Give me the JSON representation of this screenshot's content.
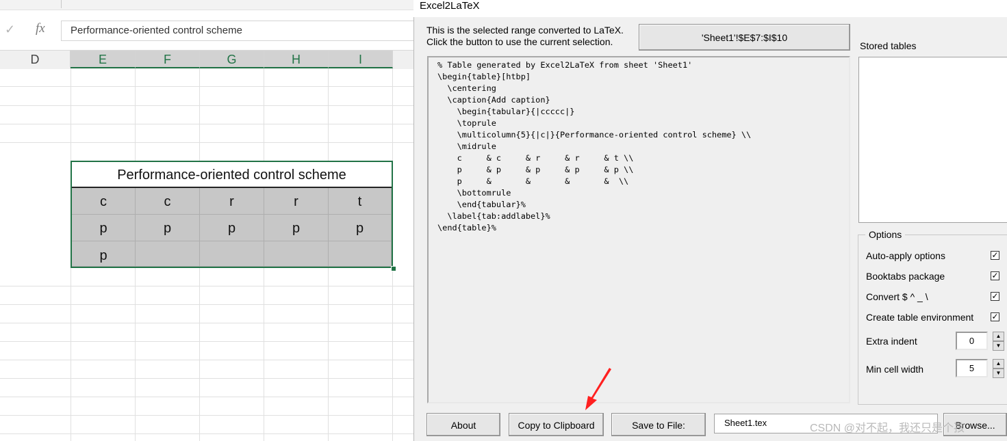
{
  "excel": {
    "formula_bar": {
      "cancel_icon": "check-icon",
      "fx_label": "fx",
      "value": "Performance-oriented control scheme"
    },
    "columns": [
      "D",
      "E",
      "F",
      "G",
      "H",
      "I"
    ],
    "selected_columns": [
      "E",
      "F",
      "G",
      "H",
      "I"
    ],
    "table": {
      "title": "Performance-oriented control scheme",
      "rows": [
        [
          "c",
          "c",
          "r",
          "r",
          "t"
        ],
        [
          "p",
          "p",
          "p",
          "p",
          "p"
        ],
        [
          "p",
          "",
          "",
          "",
          ""
        ]
      ]
    },
    "selection_color": "#217346"
  },
  "dialog": {
    "title": "Excel2LaTeX",
    "info_line1": "This is the selected range converted to LaTeX.",
    "info_line2": "Click the button to use the current selection.",
    "range_button": "'Sheet1'!$E$7:$I$10",
    "stored_tables_label": "Stored tables",
    "latex_output": "% Table generated by Excel2LaTeX from sheet 'Sheet1'\n\\begin{table}[htbp]\n  \\centering\n  \\caption{Add caption}\n    \\begin{tabular}{|ccccc|}\n    \\toprule\n    \\multicolumn{5}{|c|}{Performance-oriented control scheme} \\\\\n    \\midrule\n    c     & c     & r     & r     & t \\\\\n    p     & p     & p     & p     & p \\\\\n    p     &       &       &       &  \\\\\n    \\bottomrule\n    \\end{tabular}%\n  \\label{tab:addlabel}%\n\\end{table}%",
    "options": {
      "legend": "Options",
      "auto_apply": {
        "label": "Auto-apply options",
        "checked": true,
        "mark": "✓"
      },
      "booktabs": {
        "label": "Booktabs package",
        "checked": true,
        "mark": "✓"
      },
      "convert": {
        "label": "Convert $ ^ _ \\",
        "checked": true,
        "mark": "✓"
      },
      "create_env": {
        "label": "Create table environment",
        "checked": true,
        "mark": "✓"
      },
      "extra_indent": {
        "label": "Extra indent",
        "value": "0"
      },
      "min_cell_width": {
        "label": "Min cell width",
        "value": "5"
      }
    },
    "buttons": {
      "about": "About",
      "copy": "Copy to Clipboard",
      "save": "Save to File:",
      "file_name": "Sheet1.tex",
      "browse": "Browse..."
    },
    "spin_up_glyph": "▲",
    "spin_down_glyph": "▼"
  },
  "watermark": "CSDN @对不起，我还只是个孩",
  "annotation_color": "#ff2020"
}
